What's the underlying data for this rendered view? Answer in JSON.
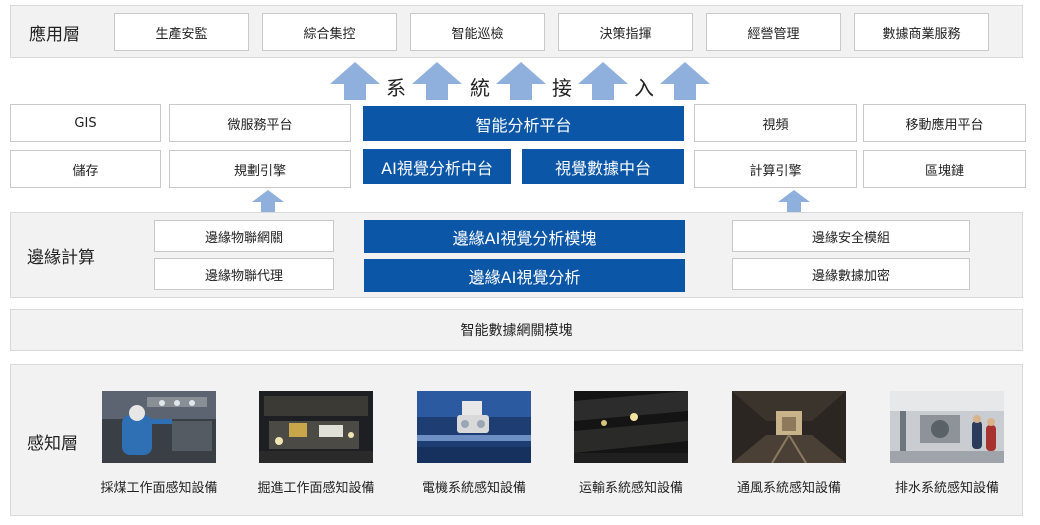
{
  "application_layer": {
    "label": "應用層",
    "items": [
      "生產安監",
      "綜合集控",
      "智能巡檢",
      "決策指揮",
      "經營管理",
      "數據商業服務"
    ]
  },
  "system_access": {
    "chars": [
      "系",
      "統",
      "接",
      "入"
    ]
  },
  "platform": {
    "left_row1": [
      "GIS",
      "微服務平台"
    ],
    "left_row2": [
      "儲存",
      "規劃引擎"
    ],
    "center_top": "智能分析平台",
    "center_bottom": [
      "AI視覺分析中台",
      "視覺數據中台"
    ],
    "right_row1": [
      "視頻",
      "移動應用平台"
    ],
    "right_row2": [
      "計算引擎",
      "區塊鏈"
    ]
  },
  "edge_layer": {
    "label": "邊緣計算",
    "left": [
      "邊緣物聯網關",
      "邊緣物聯代理"
    ],
    "center": [
      "邊緣AI視覺分析模塊",
      "邊緣AI視覺分析"
    ],
    "right": [
      "邊緣安全模組",
      "邊緣數據加密"
    ]
  },
  "gateway": {
    "label": "智能數據網關模塊"
  },
  "perception_layer": {
    "label": "感知層",
    "devices": [
      {
        "caption": "採煤工作面感知設備",
        "icon": "miner-worker-photo"
      },
      {
        "caption": "掘進工作面感知設備",
        "icon": "tunnel-machine-photo"
      },
      {
        "caption": "電機系統感知設備",
        "icon": "motor-sensor-photo"
      },
      {
        "caption": "运輸系統感知設備",
        "icon": "conveyor-tunnel-photo"
      },
      {
        "caption": "通風系統感知設備",
        "icon": "ventilation-tunnel-photo"
      },
      {
        "caption": "排水系統感知設備",
        "icon": "pump-room-photo"
      }
    ]
  },
  "colors": {
    "accent_blue": "#0b56a7",
    "arrow_blue": "#8fb0dd",
    "band_bg": "#f2f2f2"
  }
}
